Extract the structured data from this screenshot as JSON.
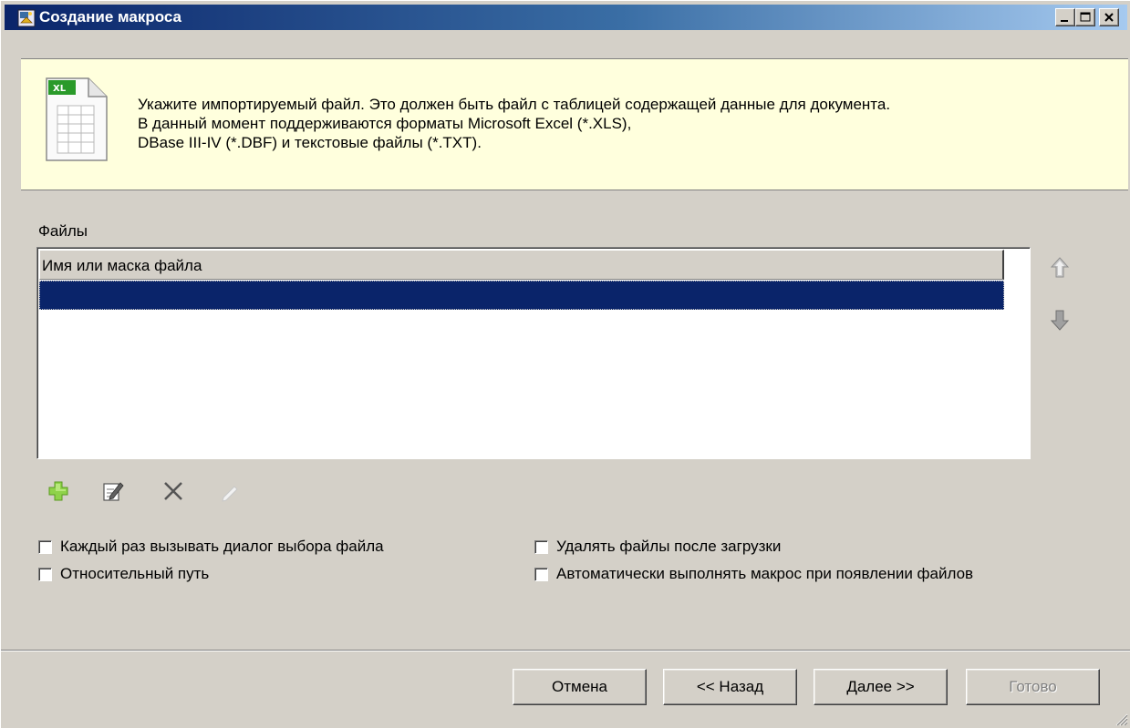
{
  "window": {
    "title": "Создание макроса",
    "icon": "macro-wizard-icon"
  },
  "banner": {
    "icon": "spreadsheet-file-icon",
    "line1": "Укажите импортируемый файл. Это должен быть файл с таблицей содержащей данные для документа.",
    "line2": "В данный момент поддерживаются форматы Microsoft Excel (*.XLS),",
    "line3": "DBase III-IV (*.DBF) и текстовые файлы (*.TXT)."
  },
  "files": {
    "label": "Файлы",
    "column_header": "Имя или маска файла",
    "rows": [
      ""
    ]
  },
  "toolbar": {
    "icons": [
      "add-icon",
      "edit-icon",
      "delete-icon",
      "clear-icon"
    ]
  },
  "options": {
    "each_time_dialog": {
      "label": "Каждый раз вызывать диалог выбора файла",
      "checked": false
    },
    "relative_path": {
      "label": "Относительный путь",
      "checked": false
    },
    "delete_after_load": {
      "label": "Удалять файлы после загрузки",
      "checked": false
    },
    "auto_run": {
      "label": "Автоматически выполнять макрос при появлении файлов",
      "checked": false
    }
  },
  "buttons": {
    "cancel": "Отмена",
    "back": "<< Назад",
    "next": "Далее >>",
    "finish": "Готово"
  },
  "colors": {
    "titlebar": "#0a246a",
    "banner_bg": "#ffffdd",
    "selection": "#0a246a",
    "face": "#d4d0c8"
  }
}
